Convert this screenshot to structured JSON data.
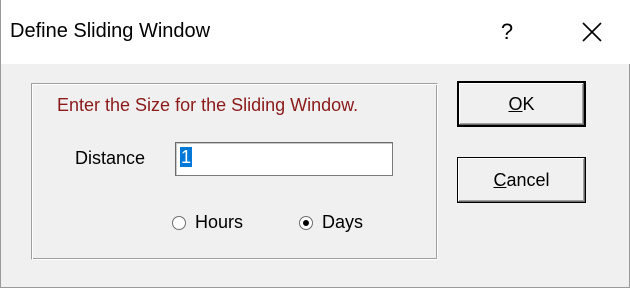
{
  "window": {
    "title": "Define Sliding Window",
    "help_label": "?"
  },
  "form": {
    "prompt": "Enter the Size for the Sliding Window.",
    "distance_label": "Distance",
    "distance_value": "1",
    "units": {
      "hours_label": "Hours",
      "days_label": "Days",
      "selected": "Days"
    }
  },
  "buttons": {
    "ok_mnemonic": "O",
    "ok_rest": "K",
    "cancel_mnemonic": "C",
    "cancel_rest": "ancel"
  },
  "icons": {
    "help": "help-icon",
    "close": "close-icon"
  }
}
